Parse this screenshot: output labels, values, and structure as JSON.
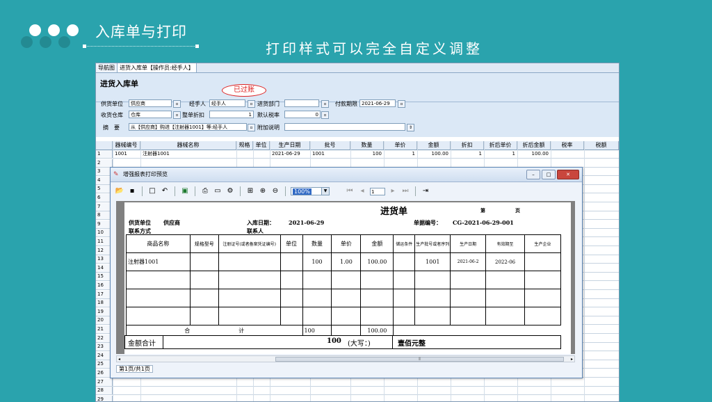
{
  "slide": {
    "title": "入库单与打印",
    "subtitle": "打印样式可以完全自定义调整"
  },
  "app": {
    "tabs": [
      "导航图",
      "进货入库单【操作员:经手人】"
    ],
    "form_title": "进货入库单",
    "status_badge": "已过账",
    "fields": {
      "supplier_label": "供货单位",
      "supplier_value": "供应商",
      "handler_label": "经手人",
      "handler_value": "经手人",
      "dept_label": "进货部门",
      "dept_value": "",
      "payment_date_label": "付款期限",
      "payment_date_value": "2021-06-29",
      "warehouse_label": "收货仓库",
      "warehouse_value": "仓库",
      "discount_label": "整单折扣",
      "discount_value": "1",
      "tax_label": "默认税率",
      "tax_value": "0",
      "summary_label": "摘　要",
      "summary_value": "从【供应商】购进【注射器1001】等:经手人",
      "note_label": "附加说明",
      "note_value": ""
    },
    "grid": {
      "headers": [
        "器械编号",
        "器械名称",
        "规格",
        "单位",
        "生产日期",
        "批号",
        "数量",
        "单价",
        "金额",
        "折扣",
        "折后单价",
        "折后金额",
        "税率",
        "税额"
      ],
      "rows": [
        [
          "1001",
          "注射器1001",
          "",
          "",
          "2021-06-29",
          "1001",
          "100",
          "1",
          "100.00",
          "1",
          "1",
          "100.00",
          "",
          ""
        ]
      ],
      "row_numbers": [
        "1",
        "2",
        "3",
        "4",
        "5",
        "6",
        "7",
        "8",
        "9",
        "10",
        "11",
        "12",
        "13",
        "14",
        "15",
        "16",
        "17",
        "18",
        "19",
        "20",
        "21",
        "22",
        "23",
        "24",
        "25",
        "26",
        "27",
        "28",
        "29"
      ]
    }
  },
  "dialog": {
    "title": "增强报表打印预览",
    "zoom": "100%",
    "page_input": "1",
    "status": "第1页/共1页",
    "report": {
      "title": "进货单",
      "page_label": "第",
      "page_suffix": "页",
      "supplier_label": "供货单位",
      "supplier_value": "供应商",
      "contact_label": "联系方式",
      "date_label": "入库日期：",
      "date_value": "2021-06-29",
      "contact_person_label": "联系人",
      "doc_no_label": "单据编号：",
      "doc_no_value": "CG-2021-06-29-001",
      "headers": [
        "商品名称",
        "规格型号",
        "注册证号(或者备案凭证编号)",
        "单位",
        "数量",
        "单价",
        "金额",
        "储运条件",
        "生产批号或者序列",
        "生产日期",
        "有效期至",
        "生产企业"
      ],
      "row": [
        "注射器1001",
        "",
        "",
        "",
        "100",
        "1.00",
        "100.00",
        "",
        "1001",
        "2021-06-2",
        "2022-06",
        ""
      ],
      "total_label_1": "合",
      "total_label_2": "计",
      "total_qty": "100",
      "total_amount": "100.00",
      "amount_sum_label": "金额合计",
      "amount_sum_value": "100",
      "capital_label": "(大写：)",
      "capital_value": "壹佰元整"
    }
  }
}
